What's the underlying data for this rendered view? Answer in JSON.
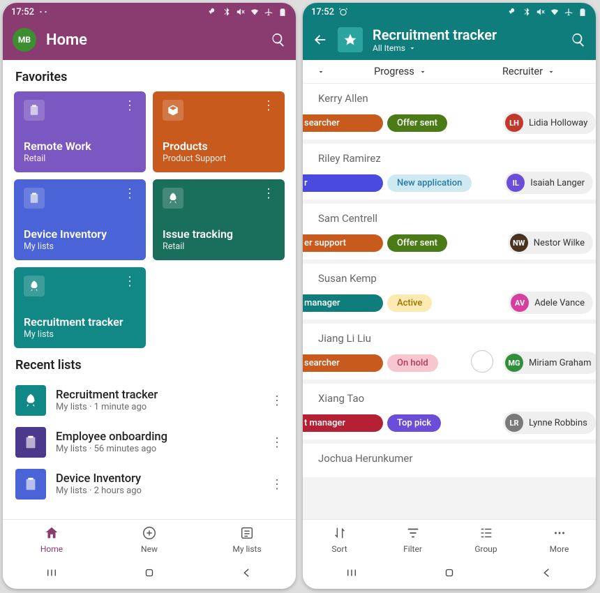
{
  "status": {
    "time": "17:52"
  },
  "home": {
    "accent": "#8a3c71",
    "header_bg": "#8a3c71",
    "avatar": {
      "initials": "MB",
      "bg": "#3b8f2e"
    },
    "title": "Home",
    "favorites_heading": "Favorites",
    "favorites": [
      {
        "name": "Remote Work",
        "sub": "Retail",
        "bg": "#7b57c2",
        "icon": "clipboard"
      },
      {
        "name": "Products",
        "sub": "Product Support",
        "bg": "#c85a1e",
        "icon": "cube"
      },
      {
        "name": "Device Inventory",
        "sub": "My lists",
        "bg": "#4a63d6",
        "icon": "clipboard"
      },
      {
        "name": "Issue tracking",
        "sub": "Retail",
        "bg": "#1a6e5c",
        "icon": "rocket"
      },
      {
        "name": "Recruitment tracker",
        "sub": "My lists",
        "bg": "#128886",
        "icon": "rocket"
      }
    ],
    "recent_heading": "Recent lists",
    "recent": [
      {
        "name": "Recruitment tracker",
        "sub": "My lists · 1 minute ago",
        "bg": "#128886",
        "icon": "rocket"
      },
      {
        "name": "Employee onboarding",
        "sub": "My lists · 56 minutes ago",
        "bg": "#4b3a8c",
        "icon": "clipboard"
      },
      {
        "name": "Device Inventory",
        "sub": "My lists · 2 hours ago",
        "bg": "#4a63d6",
        "icon": "clipboard"
      }
    ],
    "tabs": [
      {
        "label": "Home",
        "icon": "home",
        "active": true
      },
      {
        "label": "New",
        "icon": "plus",
        "active": false
      },
      {
        "label": "My lists",
        "icon": "lists",
        "active": false
      }
    ]
  },
  "tracker": {
    "accent": "#0f7d7b",
    "header_bg": "#0f7d7b",
    "back_icon": "←",
    "badge_bg": "#2aa3a1",
    "title": "Recruitment tracker",
    "subtitle": "All Items",
    "filters": {
      "col1": "Progress",
      "col2": "Recruiter"
    },
    "rows": [
      {
        "candidate": "Kerry Allen",
        "role": {
          "text": "searcher",
          "bg": "#c85a1e"
        },
        "progress": {
          "text": "Offer sent",
          "bg": "#4a7b17",
          "fg": "#fff"
        },
        "recruiter": {
          "name": "Lidia Holloway",
          "initials": "LH",
          "bg": "#c0392b"
        }
      },
      {
        "candidate": "Riley Ramirez",
        "role": {
          "text": "r",
          "bg": "#4a4ae0"
        },
        "progress": {
          "text": "New application",
          "bg": "#cfe9f3",
          "fg": "#2a7aa0"
        },
        "recruiter": {
          "name": "Isaiah Langer",
          "initials": "IL",
          "bg": "#6b4ed8"
        }
      },
      {
        "candidate": "Sam Centrell",
        "role": {
          "text": "er support",
          "bg": "#c85a1e"
        },
        "progress": {
          "text": "Offer sent",
          "bg": "#4a7b17",
          "fg": "#fff"
        },
        "recruiter": {
          "name": "Nestor Wilke",
          "initials": "NW",
          "bg": "#4a331f"
        }
      },
      {
        "candidate": "Susan Kemp",
        "role": {
          "text": "manager",
          "bg": "#0f7d7b"
        },
        "progress": {
          "text": "Active",
          "bg": "#fde9b2",
          "fg": "#9a7400"
        },
        "recruiter": {
          "name": "Adele Vance",
          "initials": "AV",
          "bg": "#d63ea0"
        }
      },
      {
        "candidate": "Jiang Li Liu",
        "role": {
          "text": "searcher",
          "bg": "#c85a1e"
        },
        "progress": {
          "text": "On hold",
          "bg": "#f7c6cf",
          "fg": "#b43b55"
        },
        "recruiter": {
          "name": "Miriam Graham",
          "initials": "MG",
          "bg": "#2f8f3a"
        },
        "overlay": true
      },
      {
        "candidate": "Xiang Tao",
        "role": {
          "text": "t manager",
          "bg": "#b52034"
        },
        "progress": {
          "text": "Top pick",
          "bg": "#6b4ed8",
          "fg": "#fff"
        },
        "recruiter": {
          "name": "Lynne Robbins",
          "initials": "LR",
          "bg": "#7a7a7a"
        }
      },
      {
        "candidate": "Jochua Herunkumer",
        "role": null,
        "progress": null,
        "recruiter": null
      }
    ],
    "tabs": [
      {
        "label": "Sort",
        "icon": "sort"
      },
      {
        "label": "Filter",
        "icon": "filter"
      },
      {
        "label": "Group",
        "icon": "group"
      },
      {
        "label": "More",
        "icon": "more"
      }
    ]
  }
}
